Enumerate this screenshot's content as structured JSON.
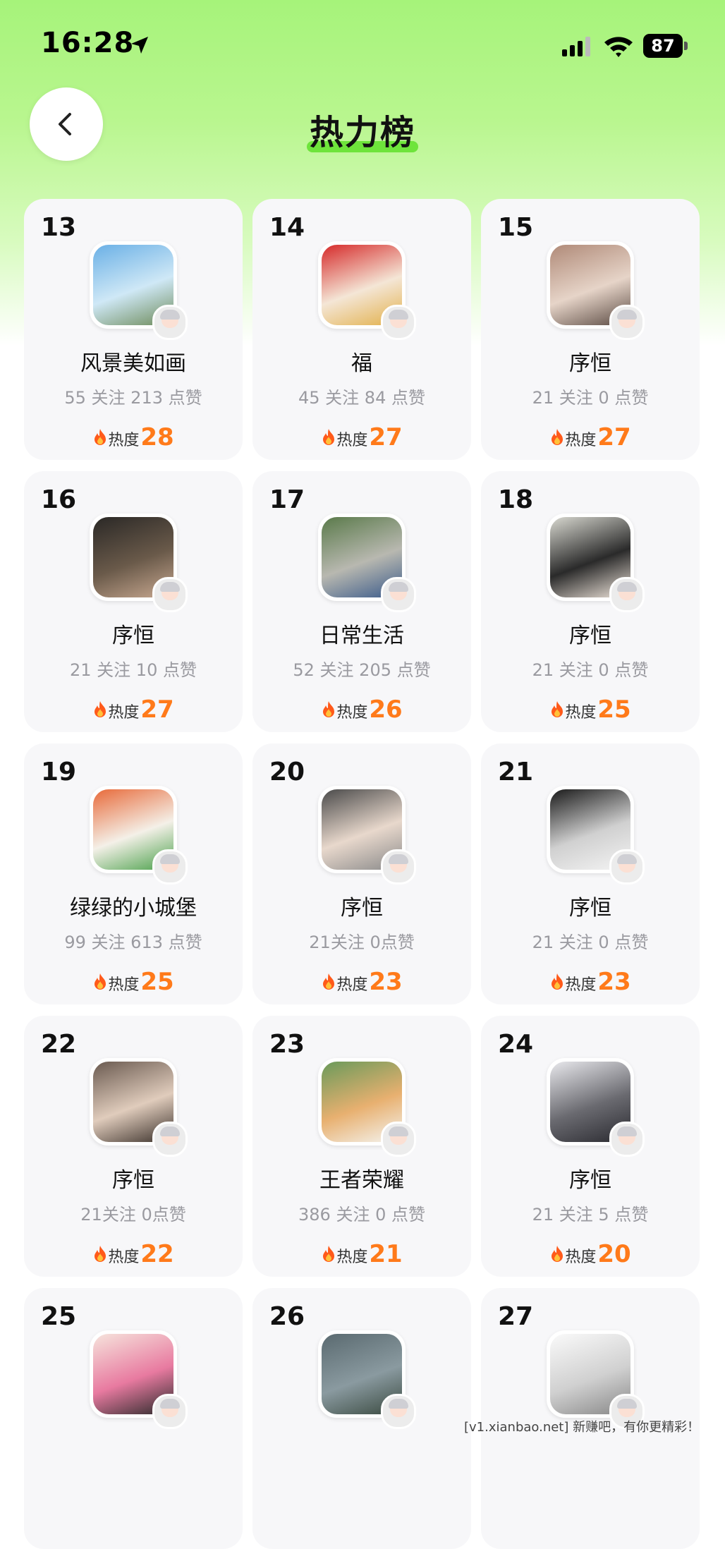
{
  "status_bar": {
    "time": "16:28",
    "battery": "87"
  },
  "header": {
    "title": "热力榜"
  },
  "heat_label": "热度",
  "cards": [
    {
      "rank": "13",
      "name": "风景美如画",
      "stats": "55 关注 213 点赞",
      "heat": "28",
      "avatar_colors": [
        "#6ab0e6",
        "#cfe8f6",
        "#6d8b5a"
      ]
    },
    {
      "rank": "14",
      "name": "福",
      "stats": "45 关注 84 点赞",
      "heat": "27",
      "avatar_colors": [
        "#d62a2a",
        "#f4e6d6",
        "#e2b04a"
      ]
    },
    {
      "rank": "15",
      "name": "序恒",
      "stats": "21 关注 0 点赞",
      "heat": "27",
      "avatar_colors": [
        "#b08a78",
        "#e6d4c8",
        "#5a4a42"
      ]
    },
    {
      "rank": "16",
      "name": "序恒",
      "stats": "21 关注 10 点赞",
      "heat": "27",
      "avatar_colors": [
        "#2a2826",
        "#6a5a4a",
        "#c8a890"
      ]
    },
    {
      "rank": "17",
      "name": "日常生活",
      "stats": "52 关注 205 点赞",
      "heat": "26",
      "avatar_colors": [
        "#5a7a4a",
        "#b8b8b0",
        "#3a5a8a"
      ]
    },
    {
      "rank": "18",
      "name": "序恒",
      "stats": "21 关注 0 点赞",
      "heat": "25",
      "avatar_colors": [
        "#d8d8d0",
        "#2a2a2a",
        "#f0e6dc"
      ]
    },
    {
      "rank": "19",
      "name": "绿绿的小城堡",
      "stats": "99 关注 613 点赞",
      "heat": "25",
      "avatar_colors": [
        "#e86a3a",
        "#f4f0e8",
        "#4aa04a"
      ]
    },
    {
      "rank": "20",
      "name": "序恒",
      "stats": "21关注 0点赞",
      "heat": "23",
      "avatar_colors": [
        "#4a4a4a",
        "#e8d8cc",
        "#8a8a8a"
      ]
    },
    {
      "rank": "21",
      "name": "序恒",
      "stats": "21 关注 0 点赞",
      "heat": "23",
      "avatar_colors": [
        "#1a1a1a",
        "#d0d0d0",
        "#f4f4f4"
      ]
    },
    {
      "rank": "22",
      "name": "序恒",
      "stats": "21关注 0点赞",
      "heat": "22",
      "avatar_colors": [
        "#6a5a50",
        "#e0ccbc",
        "#3a302a"
      ]
    },
    {
      "rank": "23",
      "name": "王者荣耀",
      "stats": "386 关注 0 点赞",
      "heat": "21",
      "avatar_colors": [
        "#6a9a5a",
        "#e8b070",
        "#f4f4f0"
      ]
    },
    {
      "rank": "24",
      "name": "序恒",
      "stats": "21 关注 5 点赞",
      "heat": "20",
      "avatar_colors": [
        "#e8e8ec",
        "#6a6a70",
        "#2a2a30"
      ]
    },
    {
      "rank": "25",
      "name": "",
      "stats": "",
      "heat": "",
      "avatar_colors": [
        "#f6e4dc",
        "#e87aa0",
        "#2a2a2a"
      ]
    },
    {
      "rank": "26",
      "name": "",
      "stats": "",
      "heat": "",
      "avatar_colors": [
        "#5a6a70",
        "#8a9aa0",
        "#3a4a40"
      ]
    },
    {
      "rank": "27",
      "name": "",
      "stats": "",
      "heat": "",
      "avatar_colors": [
        "#fafafa",
        "#d0d0d0",
        "#888888"
      ]
    }
  ],
  "watermark": "[v1.xianbao.net] 新赚吧，有你更精彩！",
  "colors": {
    "accent_green": "#5fe02a",
    "heat_orange": "#ff7a1a",
    "card_bg": "#f7f7f9"
  }
}
